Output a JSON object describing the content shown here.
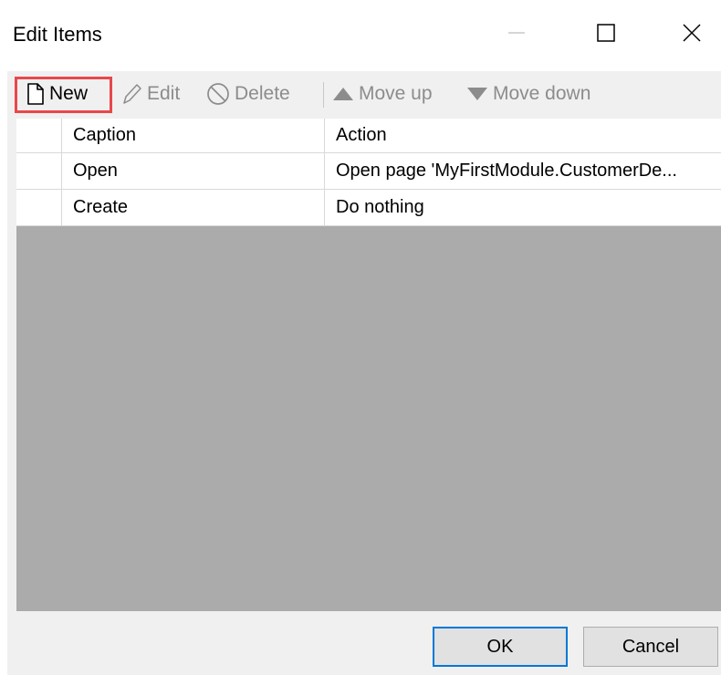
{
  "window": {
    "title": "Edit Items"
  },
  "toolbar": {
    "new_label": "New",
    "edit_label": "Edit",
    "delete_label": "Delete",
    "move_up_label": "Move up",
    "move_down_label": "Move down",
    "highlight_color": "#e8474b"
  },
  "grid": {
    "columns": [
      "Caption",
      "Action"
    ],
    "rows": [
      {
        "caption": "Open",
        "action": "Open page 'MyFirstModule.CustomerDe..."
      },
      {
        "caption": "Create",
        "action": "Do nothing"
      }
    ]
  },
  "footer": {
    "ok_label": "OK",
    "cancel_label": "Cancel",
    "focus_color": "#0078d7"
  },
  "icons": {
    "new": "new-document-icon",
    "edit": "pencil-icon",
    "delete": "prohibited-icon",
    "move_up": "triangle-up-icon",
    "move_down": "triangle-down-icon",
    "minimize": "minimize-icon",
    "maximize": "maximize-icon",
    "close": "close-icon"
  }
}
